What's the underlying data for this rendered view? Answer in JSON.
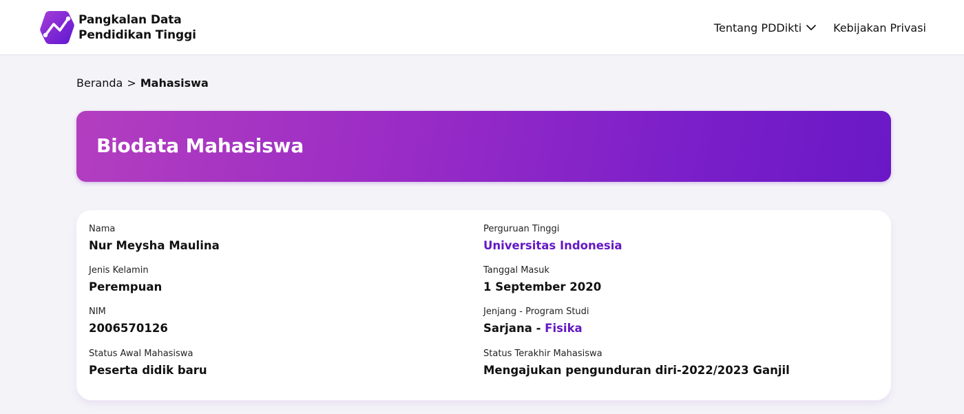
{
  "header": {
    "brand_line1": "Pangkalan Data",
    "brand_line2": "Pendidikan Tinggi",
    "logo_icon": "pddikti-hexagon-chart-logo",
    "logo_colors": [
      "#a63dd8",
      "#5e17d1"
    ],
    "nav": [
      {
        "label": "Tentang PDDikti",
        "icon": "chevron-down-icon"
      },
      {
        "label": "Kebijakan Privasi"
      }
    ]
  },
  "breadcrumb": {
    "home": "Beranda",
    "separator": ">",
    "current": "Mahasiswa"
  },
  "banner": {
    "title": "Biodata Mahasiswa"
  },
  "biodata": {
    "nama": {
      "label": "Nama",
      "value": "Nur Meysha Maulina"
    },
    "jenis_kelamin": {
      "label": "Jenis Kelamin",
      "value": "Perempuan"
    },
    "nim": {
      "label": "NIM",
      "value": "2006570126"
    },
    "status_awal": {
      "label": "Status Awal Mahasiswa",
      "value": "Peserta didik baru"
    },
    "perguruan_tinggi": {
      "label": "Perguruan Tinggi",
      "value": "Universitas Indonesia"
    },
    "tanggal_masuk": {
      "label": "Tanggal Masuk",
      "value": "1 September 2020"
    },
    "jenjang_prodi": {
      "label": "Jenjang - Program Studi",
      "jenjang": "Sarjana",
      "separator": " - ",
      "prodi": "Fisika"
    },
    "status_terakhir": {
      "label": "Status Terakhir Mahasiswa",
      "value": "Mengajukan pengunduran diri-2022/2023 Ganjil"
    }
  },
  "colors": {
    "accent": "#6418c4",
    "banner_gradient": [
      "#b33ebf",
      "#6a18c6"
    ],
    "page_background": "#f4f3f8"
  }
}
